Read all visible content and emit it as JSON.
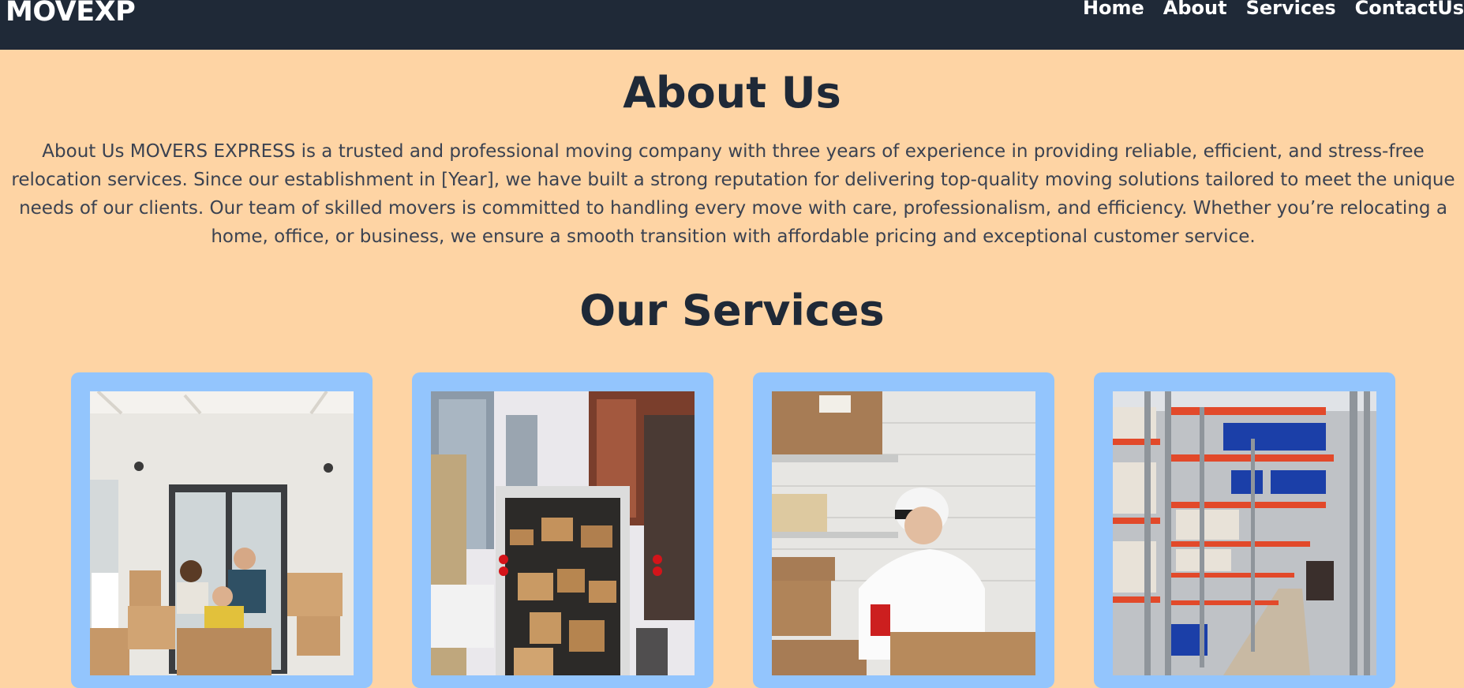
{
  "nav": {
    "brand": "MOVEXP",
    "links": [
      {
        "label": "Home"
      },
      {
        "label": "About"
      },
      {
        "label": "Services"
      },
      {
        "label": "ContactUs"
      }
    ]
  },
  "about": {
    "title": "About Us",
    "text": "About Us MOVERS EXPRESS is a trusted and professional moving company with three years of experience in providing reliable, efficient, and stress-free relocation services. Since our establishment in [Year], we have built a strong reputation for delivering top-quality moving solutions tailored to meet the unique needs of our clients. Our team of skilled movers is committed to handling every move with care, professionalism, and efficiency. Whether you’re relocating a home, office, or business, we ensure a smooth transition with affordable pricing and exceptional customer service."
  },
  "services": {
    "title": "Our Services",
    "cards": [
      {
        "image": "family-moving-photo"
      },
      {
        "image": "moving-truck-photo"
      },
      {
        "image": "packing-worker-photo"
      },
      {
        "image": "warehouse-photo"
      }
    ]
  },
  "colors": {
    "nav_bg": "#1f2937",
    "page_bg": "#fed4a4",
    "card_bg": "#93c5fd",
    "text_dark": "#1f2937"
  }
}
